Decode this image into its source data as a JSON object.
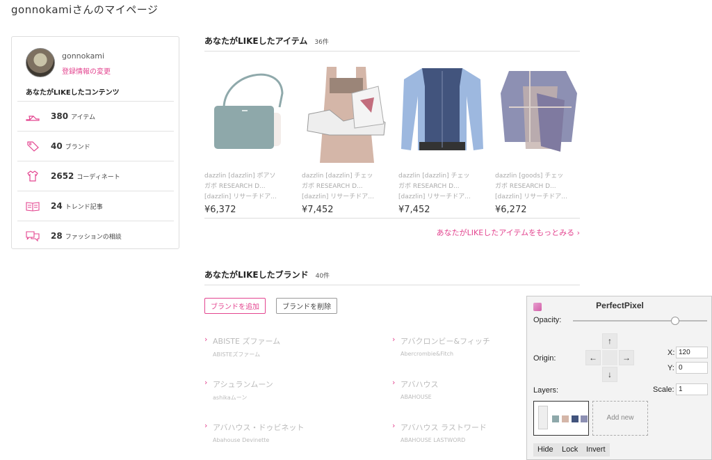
{
  "page": {
    "title": "gonnokamiさんのマイページ"
  },
  "sidebar": {
    "username": "gonnokami",
    "profile_link": "登録情報の変更",
    "contents_heading": "あなたがLIKEしたコンテンツ",
    "items": [
      {
        "icon": "heel-shoe-icon",
        "count": "380",
        "label": "アイテム"
      },
      {
        "icon": "tag-icon",
        "count": "40",
        "label": "ブランド"
      },
      {
        "icon": "outfit-icon",
        "count": "2652",
        "label": "コーディネート"
      },
      {
        "icon": "magazine-icon",
        "count": "24",
        "label": "トレンド記事"
      },
      {
        "icon": "chat-bubble-icon",
        "count": "28",
        "label": "ファッションの相談"
      }
    ]
  },
  "liked_items": {
    "heading": "あなたがLIKEしたアイテム",
    "count": "36件",
    "more_link": "あなたがLIKEしたアイテムをもっとみる",
    "items": [
      {
        "name1": "dazzlin [dazzlin] ポアソ",
        "name2": "ガボ RESEARCH D...",
        "name3": "[dazzlin] リサーチドア...",
        "price": "¥6,372"
      },
      {
        "name1": "dazzlin [dazzlin] チェッ",
        "name2": "ガボ RESEARCH D...",
        "name3": "[dazzlin] リサーチドア...",
        "price": "¥7,452"
      },
      {
        "name1": "dazzlin [dazzlin] チェッ",
        "name2": "ガボ RESEARCH D...",
        "name3": "[dazzlin] リサーチドア...",
        "price": "¥7,452"
      },
      {
        "name1": "dazzlin [goods] チェッ",
        "name2": "ガボ RESEARCH D...",
        "name3": "[dazzlin] リサーチドア...",
        "price": "¥6,272"
      }
    ]
  },
  "liked_brands": {
    "heading": "あなたがLIKEしたブランド",
    "count": "40件",
    "add_button": "ブランドを追加",
    "remove_button": "ブランドを削除",
    "brands": [
      {
        "name": "ABISTE ズファーム",
        "sub": "ABISTEズファーム"
      },
      {
        "name": "アバクロンビー&フィッチ",
        "sub": "Abercrombie&Fitch"
      },
      {
        "name": "アシュランムーン",
        "sub": "ashikaムーン"
      },
      {
        "name": "アバハウス",
        "sub": "ABAHOUSE"
      },
      {
        "name": "アバハウス・ドゥビネット",
        "sub": "Abahouse Devinette"
      },
      {
        "name": "アバハウス ラストワード",
        "sub": "ABAHOUSE LASTWORD"
      }
    ]
  },
  "perfectpixel": {
    "title": "PerfectPixel",
    "opacity_label": "Opacity:",
    "opacity_value": 0.78,
    "origin_label": "Origin:",
    "x_label": "X:",
    "x_value": "120",
    "y_label": "Y:",
    "y_value": "0",
    "scale_label": "Scale:",
    "scale_value": "1",
    "layers_label": "Layers:",
    "add_new": "Add new",
    "hide": "Hide",
    "lock": "Lock",
    "invert": "Invert",
    "arrows": {
      "up": "↑",
      "down": "↓",
      "left": "←",
      "right": "→"
    }
  },
  "colors": {
    "accent": "#e3448f",
    "border": "#dddddd",
    "muted_text": "#aaaaaa"
  }
}
